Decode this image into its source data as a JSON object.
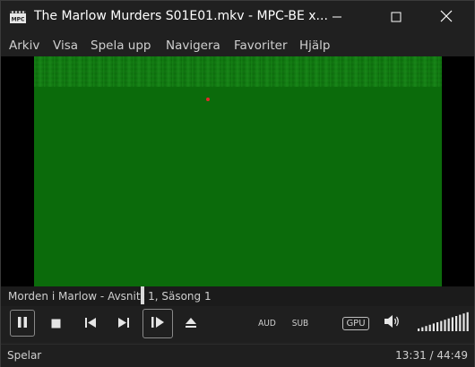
{
  "window": {
    "title": "The Marlow Murders S01E01.mkv - MPC-BE x..."
  },
  "menu": {
    "items": [
      "Arkiv",
      "Visa",
      "Spela upp",
      "Navigera",
      "Favoriter",
      "Hjälp"
    ]
  },
  "player": {
    "now_playing": "Morden i Marlow - Avsnitt 1, Säsong 1",
    "audio_label": "AUD",
    "subtitle_label": "SUB",
    "renderer_label": "GPU"
  },
  "status": {
    "state": "Spelar",
    "time": "13:31 / 44:49"
  },
  "icons": {
    "app": "mpc-be-logo-icon",
    "minimize": "minimize-icon",
    "maximize": "maximize-icon",
    "close": "close-icon",
    "pause": "pause-icon",
    "stop": "stop-icon",
    "prev": "skip-previous-icon",
    "next": "skip-next-icon",
    "frame_step": "frame-step-icon",
    "eject": "eject-icon",
    "volume": "speaker-icon"
  },
  "colors": {
    "background": "#202020",
    "video_green": "#0b6b0b",
    "text": "#cfcfcf"
  },
  "volume_level": 1.0
}
